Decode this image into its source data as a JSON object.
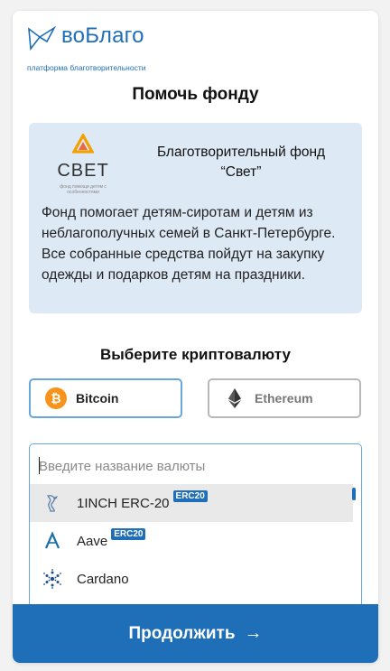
{
  "brand": {
    "name": "воБлаго",
    "tagline": "платформа благотворительности",
    "color": "#1f6fb8"
  },
  "page": {
    "title": "Помочь фонду"
  },
  "fund": {
    "logo_text": "СВЕТ",
    "logo_subtext": "фонд помощи детям с особенностями",
    "name": "Благотворительный фонд “Свет”",
    "description": "Фонд помогает детям-сиротам и детям из неблагополучных семей в Санкт-Петербурге. Все собранные средства пойдут на закупку одежды и подарков детям на праздники."
  },
  "crypto": {
    "heading": "Выберите криптовалюту",
    "options": [
      {
        "label": "Bitcoin",
        "icon": "bitcoin-icon",
        "selected": true
      },
      {
        "label": "Ethereum",
        "icon": "ethereum-icon",
        "selected": false
      }
    ]
  },
  "dropdown": {
    "placeholder": "Введите название валюты",
    "value": "",
    "items": [
      {
        "label": "1INCH ERC-20",
        "badge": "ERC20",
        "icon": "1inch-icon",
        "highlighted": true
      },
      {
        "label": "Aave",
        "badge": "ERC20",
        "icon": "aave-icon",
        "highlighted": false
      },
      {
        "label": "Cardano",
        "badge": "",
        "icon": "cardano-icon",
        "highlighted": false
      }
    ]
  },
  "actions": {
    "continue_label": "Продолжить",
    "continue_arrow": "→"
  }
}
